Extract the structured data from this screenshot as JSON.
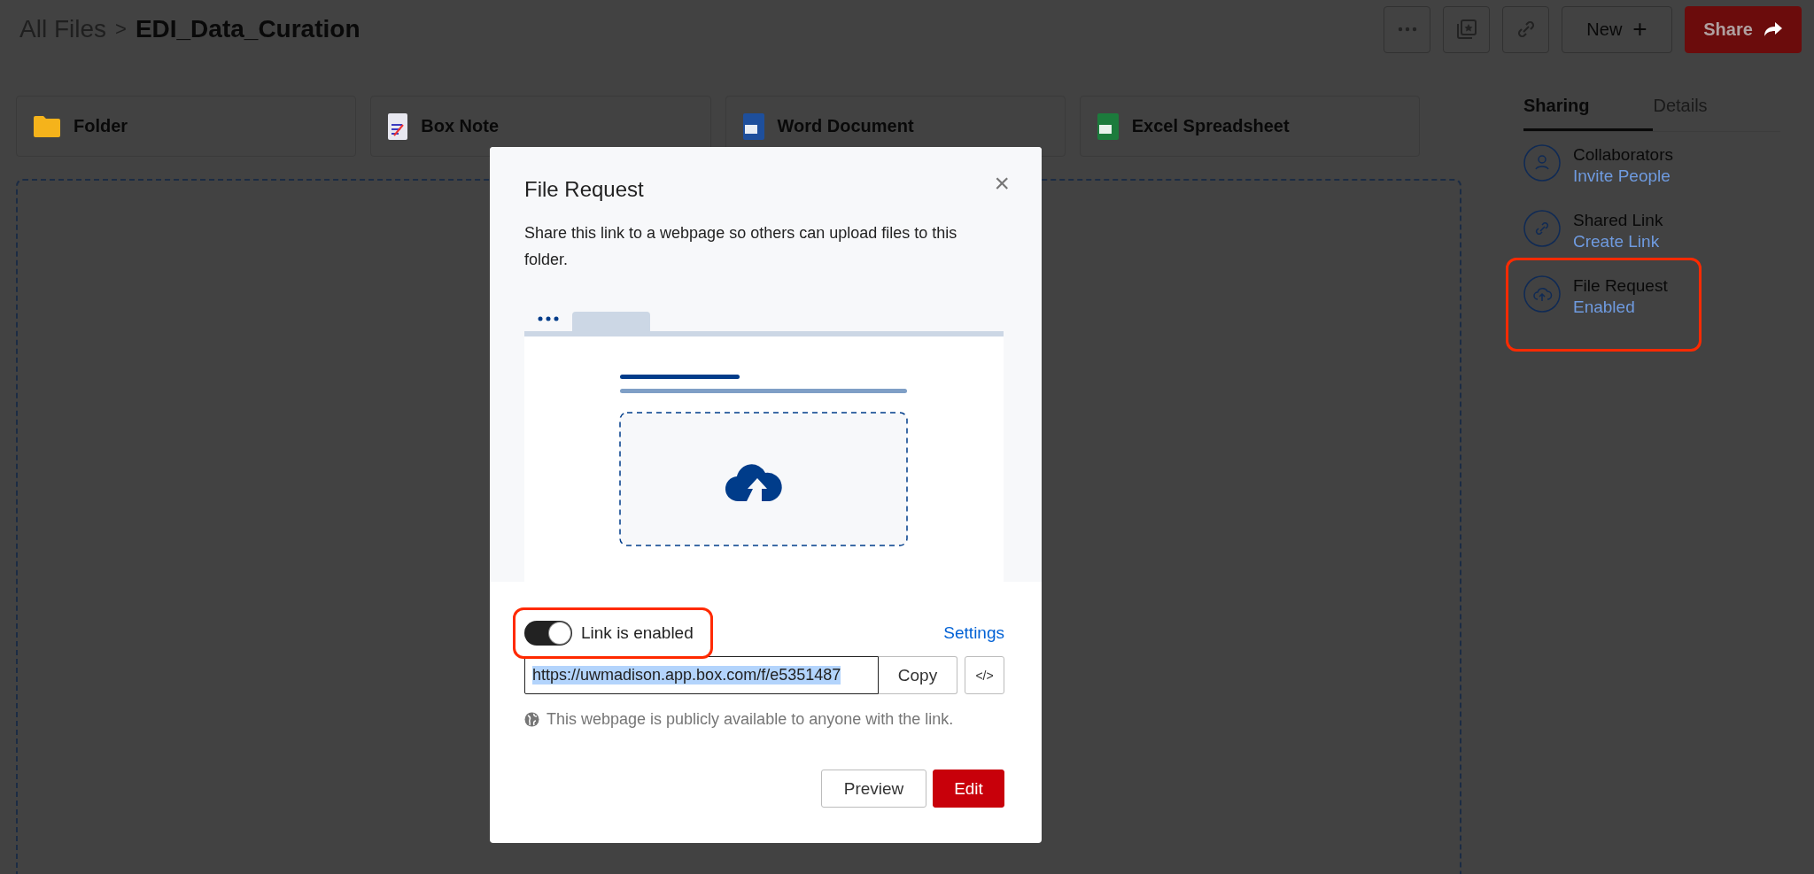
{
  "breadcrumb": {
    "parent": "All Files",
    "separator": ">",
    "current": "EDI_Data_Curation"
  },
  "toolbar": {
    "new_label": "New",
    "new_sign": "+",
    "share_label": "Share"
  },
  "new_items": [
    {
      "kind": "folder",
      "label": "Folder"
    },
    {
      "kind": "note",
      "label": "Box Note"
    },
    {
      "kind": "word",
      "label": "Word Document"
    },
    {
      "kind": "excel",
      "label": "Excel Spreadsheet"
    }
  ],
  "sidebar": {
    "tabs": [
      {
        "label": "Sharing",
        "selected": true
      },
      {
        "label": "Details",
        "selected": false
      }
    ],
    "items": [
      {
        "kind": "person",
        "title": "Collaborators",
        "action": "Invite People",
        "highlighted": false
      },
      {
        "kind": "link",
        "title": "Shared Link",
        "action": "Create Link",
        "highlighted": false
      },
      {
        "kind": "upload",
        "title": "File Request",
        "action": "Enabled",
        "highlighted": true
      }
    ]
  },
  "modal": {
    "title": "File Request",
    "close": "×",
    "description": "Share this link to a webpage so others can upload files to this folder.",
    "toggle": {
      "on": true,
      "label": "Link is enabled",
      "highlighted": true
    },
    "settings_link": "Settings",
    "url": "https://uwmadison.app.box.com/f/e5351487",
    "url_selected": true,
    "copy_label": "Copy",
    "embed_label": "</>",
    "notice": "This webpage is publicly available to anyone with the link.",
    "buttons": [
      {
        "kind": "secondary",
        "label": "Preview"
      },
      {
        "kind": "primary",
        "label": "Edit"
      }
    ]
  }
}
